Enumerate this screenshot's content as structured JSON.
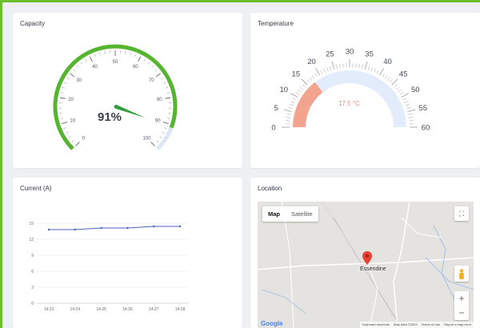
{
  "capacity": {
    "title": "Capacity",
    "value": 91,
    "value_label": "91%",
    "min": 0,
    "max": 100,
    "tick_labels": [
      "0",
      "10",
      "20",
      "30",
      "40",
      "50",
      "60",
      "70",
      "80",
      "90",
      "100"
    ],
    "color": "#56b52e",
    "track_color": "#dce6f5"
  },
  "temperature": {
    "title": "Temperature",
    "value": 17.5,
    "value_label": "17.5 °C",
    "min": 0,
    "max": 60,
    "tick_labels": [
      "0",
      "5",
      "10",
      "15",
      "20",
      "25",
      "30",
      "35",
      "40",
      "45",
      "50",
      "55",
      "60"
    ],
    "color": "#f3a48f",
    "track_color": "#e3ecfa"
  },
  "current": {
    "title": "Current (A)",
    "chart_data": {
      "type": "line",
      "categories": [
        "14:23",
        "14:24",
        "14:25",
        "14:26",
        "14:27",
        "14:28"
      ],
      "values": [
        13.8,
        13.8,
        14.1,
        14.1,
        14.4,
        14.4
      ],
      "ylim": [
        0,
        15
      ],
      "yticks": [
        "0",
        "3",
        "6",
        "9",
        "12",
        "15"
      ],
      "grid": true,
      "line_color": "#4a63c2"
    }
  },
  "location": {
    "title": "Location",
    "map_tab": "Map",
    "satellite_tab": "Satellite",
    "place": "Essendine",
    "google": "Google",
    "attribution": [
      "Keyboard shortcuts",
      "Map data ©2023",
      "Terms of Use",
      "Report a map error"
    ]
  }
}
